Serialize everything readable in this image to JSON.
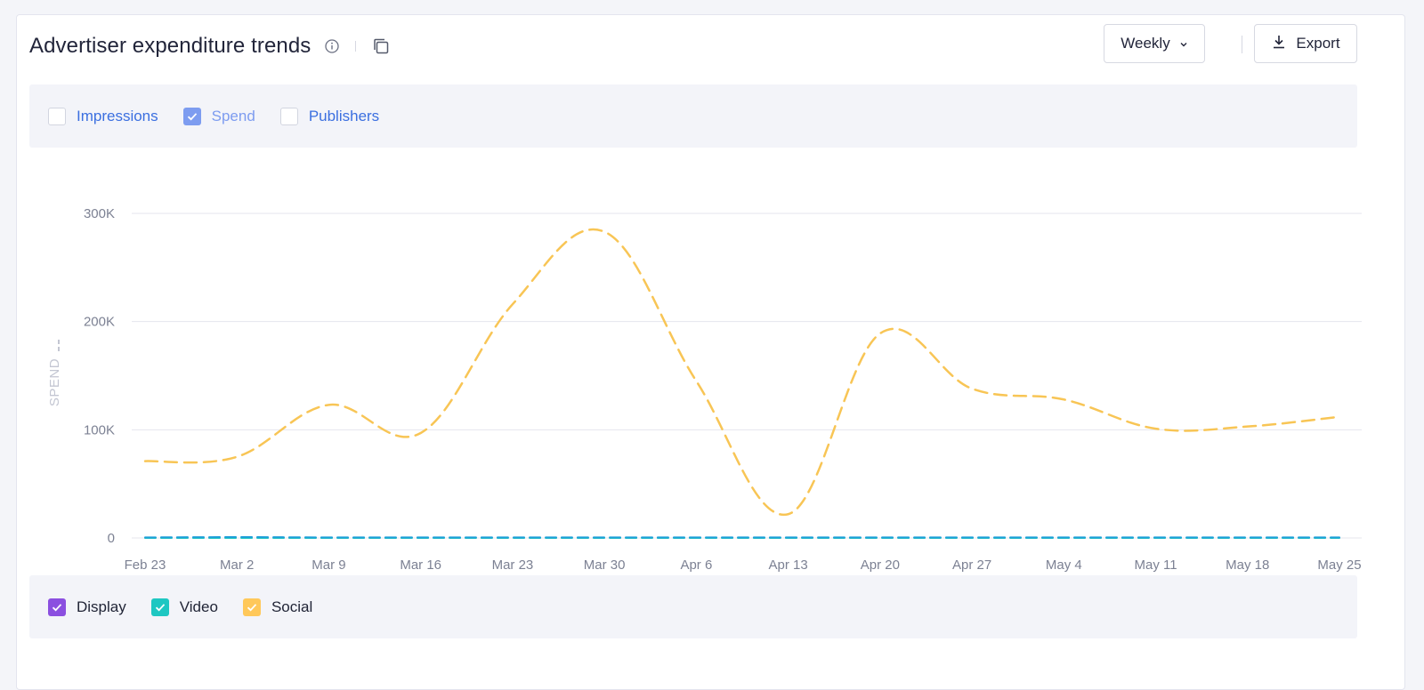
{
  "header": {
    "title": "Advertiser expenditure trends",
    "period_label": "Weekly",
    "export_label": "Export"
  },
  "metrics": [
    {
      "label": "Impressions",
      "checked": false
    },
    {
      "label": "Spend",
      "checked": true
    },
    {
      "label": "Publishers",
      "checked": false
    }
  ],
  "legend": [
    {
      "label": "Display",
      "color": "#8b4fe0",
      "checked": true
    },
    {
      "label": "Video",
      "color": "#1ec7c2",
      "checked": true
    },
    {
      "label": "Social",
      "color": "#ffc85a",
      "checked": true
    }
  ],
  "colors": {
    "accent": "#3b6fe0",
    "metric_checked": "#7d9cf0",
    "grid": "#e4e6ee",
    "tick": "#7c8193",
    "social_line": "#f8c555",
    "display_line": "#1e9fd8"
  },
  "chart_data": {
    "type": "line",
    "line_style": "dashed",
    "ylabel": "SPEND",
    "ylim": [
      0,
      300000
    ],
    "yticks": [
      {
        "value": 0,
        "label": "0"
      },
      {
        "value": 100000,
        "label": "100K"
      },
      {
        "value": 200000,
        "label": "200K"
      },
      {
        "value": 300000,
        "label": "300K"
      }
    ],
    "categories": [
      "Feb 23",
      "Mar 2",
      "Mar 9",
      "Mar 16",
      "Mar 23",
      "Mar 30",
      "Apr 6",
      "Apr 13",
      "Apr 20",
      "Apr 27",
      "May 4",
      "May 11",
      "May 18",
      "May 25"
    ],
    "series": [
      {
        "name": "Display",
        "color": "#1e9fd8",
        "values": [
          500,
          800,
          500,
          500,
          500,
          500,
          500,
          500,
          500,
          500,
          500,
          500,
          500,
          500
        ]
      },
      {
        "name": "Video",
        "color": "#1ec7c2",
        "values": [
          0,
          0,
          0,
          0,
          0,
          0,
          0,
          0,
          0,
          0,
          0,
          0,
          0,
          0
        ]
      },
      {
        "name": "Social",
        "color": "#f8c555",
        "values": [
          71000,
          75000,
          123000,
          97000,
          216000,
          283000,
          145000,
          22000,
          189000,
          138000,
          128000,
          101000,
          103000,
          112000
        ]
      }
    ],
    "grid": true,
    "legend_position": "bottom-left"
  }
}
